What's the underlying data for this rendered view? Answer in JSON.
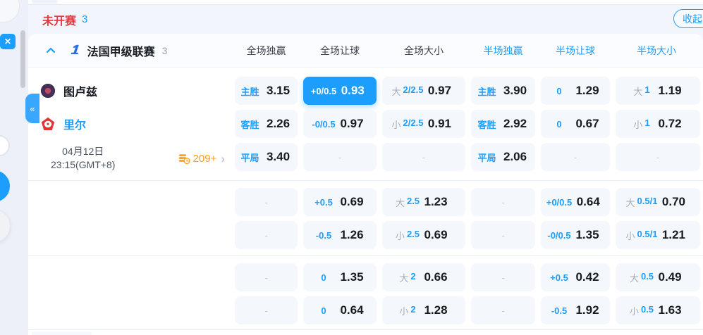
{
  "icons": {
    "close": "✕",
    "collapse_left": "«",
    "chevron_right": "›",
    "league_logo_char": "1"
  },
  "toolbar": {
    "status_title": "未开赛",
    "status_count": "3",
    "collapse_button": "收起"
  },
  "league_header": {
    "name": "法国甲级联赛",
    "count": "3",
    "columns": [
      "全场独赢",
      "全场让球",
      "全场大小",
      "半场独赢",
      "半场让球",
      "半场大小"
    ]
  },
  "match": {
    "home_team": "图卢兹",
    "away_team": "里尔",
    "date": "04月12日",
    "time": "23:15(GMT+8)",
    "more_markets": "209+"
  },
  "odds": {
    "dash": "-",
    "rows": [
      {
        "cells": [
          {
            "label": "主胜",
            "value": "3.15"
          },
          {
            "label": "+0/0.5",
            "value": "0.93",
            "selected": true
          },
          {
            "side": "大",
            "line": "2/2.5",
            "value": "0.97"
          },
          {
            "label": "主胜",
            "value": "3.90"
          },
          {
            "label": "0",
            "value": "1.29"
          },
          {
            "side": "大",
            "line": "1",
            "value": "1.19"
          }
        ]
      },
      {
        "cells": [
          {
            "label": "客胜",
            "value": "2.26"
          },
          {
            "label": "-0/0.5",
            "value": "0.97"
          },
          {
            "side": "小",
            "line": "2/2.5",
            "value": "0.91"
          },
          {
            "label": "客胜",
            "value": "2.92"
          },
          {
            "label": "0",
            "value": "0.67"
          },
          {
            "side": "小",
            "line": "1",
            "value": "0.72"
          }
        ]
      },
      {
        "cells": [
          {
            "label": "平局",
            "value": "3.40"
          },
          {
            "dash": true
          },
          {
            "dash": true
          },
          {
            "label": "平局",
            "value": "2.06"
          },
          {
            "dash": true
          },
          {
            "dash": true
          }
        ]
      },
      {
        "cells": [
          {
            "dash": true
          },
          {
            "label": "+0.5",
            "value": "0.69"
          },
          {
            "side": "大",
            "line": "2.5",
            "value": "1.23"
          },
          {
            "dash": true
          },
          {
            "label": "+0/0.5",
            "value": "0.64"
          },
          {
            "side": "大",
            "line": "0.5/1",
            "value": "0.70"
          }
        ]
      },
      {
        "cells": [
          {
            "dash": true
          },
          {
            "label": "-0.5",
            "value": "1.26"
          },
          {
            "side": "小",
            "line": "2.5",
            "value": "0.69"
          },
          {
            "dash": true
          },
          {
            "label": "-0/0.5",
            "value": "1.35"
          },
          {
            "side": "小",
            "line": "0.5/1",
            "value": "1.21"
          }
        ]
      },
      {
        "cells": [
          {
            "dash": true
          },
          {
            "label": "0",
            "value": "1.35"
          },
          {
            "side": "大",
            "line": "2",
            "value": "0.66"
          },
          {
            "dash": true
          },
          {
            "label": "+0.5",
            "value": "0.42"
          },
          {
            "side": "大",
            "line": "0.5",
            "value": "0.49"
          }
        ]
      },
      {
        "cells": [
          {
            "dash": true
          },
          {
            "label": "0",
            "value": "0.64"
          },
          {
            "side": "小",
            "line": "2",
            "value": "1.28"
          },
          {
            "dash": true
          },
          {
            "label": "-0.5",
            "value": "1.92"
          },
          {
            "side": "小",
            "line": "0.5",
            "value": "1.63"
          }
        ]
      }
    ]
  },
  "colors": {
    "accent": "#1c9eff",
    "status_red": "#e23a3e",
    "markets_orange": "#ff9d20"
  }
}
